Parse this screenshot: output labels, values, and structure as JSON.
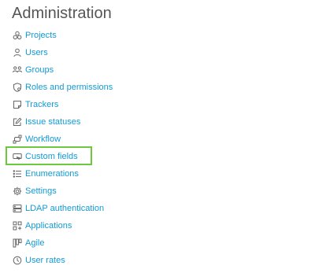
{
  "page": {
    "title": "Administration"
  },
  "menu": {
    "items": [
      {
        "label": "Projects",
        "icon": "projects-icon"
      },
      {
        "label": "Users",
        "icon": "user-icon"
      },
      {
        "label": "Groups",
        "icon": "groups-icon"
      },
      {
        "label": "Roles and permissions",
        "icon": "shield-icon"
      },
      {
        "label": "Trackers",
        "icon": "tracker-icon"
      },
      {
        "label": "Issue statuses",
        "icon": "edit-icon"
      },
      {
        "label": "Workflow",
        "icon": "workflow-icon"
      },
      {
        "label": "Custom fields",
        "icon": "custom-field-icon",
        "highlighted": true
      },
      {
        "label": "Enumerations",
        "icon": "list-icon"
      },
      {
        "label": "Settings",
        "icon": "gear-icon"
      },
      {
        "label": "LDAP authentication",
        "icon": "server-icon"
      },
      {
        "label": "Applications",
        "icon": "apps-icon"
      },
      {
        "label": "Agile",
        "icon": "agile-icon"
      },
      {
        "label": "User rates",
        "icon": "clock-icon"
      }
    ]
  },
  "colors": {
    "link": "#169ad2",
    "title": "#555555",
    "icon": "#666666",
    "highlight": "#6cc93d"
  }
}
